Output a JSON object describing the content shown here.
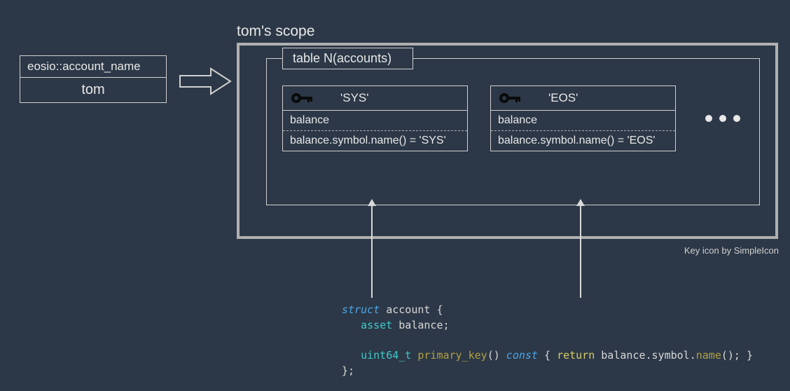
{
  "account": {
    "type_label": "eosio::account_name",
    "name": "tom"
  },
  "scope": {
    "title": "tom's scope",
    "table_label": "table N(accounts)"
  },
  "records": [
    {
      "key_symbol": "'SYS'",
      "field": "balance",
      "method": "balance.symbol.name() = 'SYS'"
    },
    {
      "key_symbol": "'EOS'",
      "field": "balance",
      "method": "balance.symbol.name() = 'EOS'"
    }
  ],
  "credit": "Key icon by SimpleIcon",
  "code": {
    "kw_struct": "struct",
    "struct_name": " account {",
    "type_asset": "asset",
    "field_balance": " balance;",
    "type_uint64": "uint64_t",
    "fn_name": " primary_key",
    "paren_const": "()",
    "kw_const": " const",
    "brace_open": " { ",
    "kw_return": "return",
    "expr1": " balance.symbol.",
    "fn_name2": "name",
    "expr2": "(); }",
    "closing": "};"
  }
}
